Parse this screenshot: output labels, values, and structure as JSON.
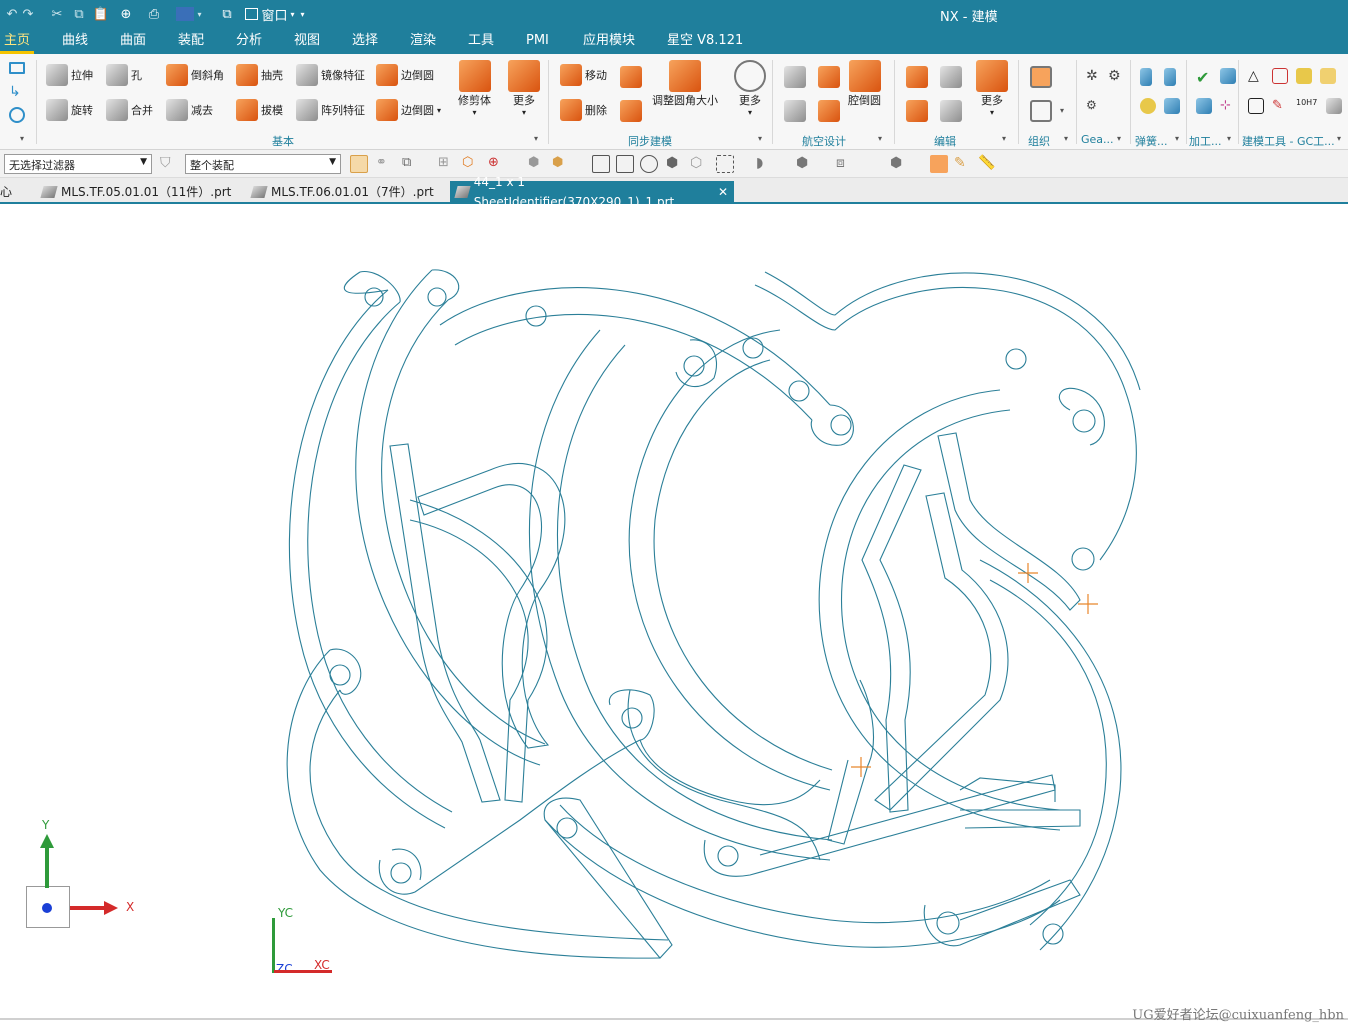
{
  "window": {
    "title": "NX - 建模"
  },
  "quick_access": {
    "window_label": "窗口",
    "icons": [
      "undo-icon",
      "redo-icon",
      "cut-icon",
      "copy-icon",
      "paste-icon",
      "touch-mode-icon",
      "print-icon",
      "display-icon",
      "window-switch-icon"
    ]
  },
  "menu_tabs": [
    {
      "label": "主页",
      "active": true
    },
    {
      "label": "曲线"
    },
    {
      "label": "曲面"
    },
    {
      "label": "装配"
    },
    {
      "label": "分析"
    },
    {
      "label": "视图"
    },
    {
      "label": "选择"
    },
    {
      "label": "渲染"
    },
    {
      "label": "工具"
    },
    {
      "label": "PMI"
    },
    {
      "label": "应用模块"
    },
    {
      "label": "星空 V8.121"
    }
  ],
  "ribbon": {
    "basic": {
      "extrude": "拉伸",
      "hole": "孔",
      "chamfer": "倒斜角",
      "shell": "抽壳",
      "mirror": "镜像特征",
      "edge_blend": "边倒圆",
      "revolve": "旋转",
      "unite": "合并",
      "subtract": "减去",
      "draft": "拔模",
      "pattern": "阵列特征",
      "edge_blend2": "边倒圆",
      "trim_body": "修剪体",
      "more": "更多",
      "label": "基本"
    },
    "sync": {
      "move": "移动",
      "delete": "删除",
      "resize_blend": "调整圆角大小",
      "more": "更多",
      "label": "同步建模"
    },
    "aero": {
      "cavity_blend": "腔倒圆",
      "label": "航空设计"
    },
    "edit": {
      "more": "更多",
      "label": "编辑"
    },
    "organize": {
      "label": "组织"
    },
    "gear": {
      "label": "Gea..."
    },
    "spring": {
      "label": "弹簧..."
    },
    "machining": {
      "label": "加工..."
    },
    "gc": {
      "label": "建模工具 - GC工..."
    }
  },
  "filterbar": {
    "type_filter": "无选择过滤器",
    "assembly_scope": "整个装配"
  },
  "doc_tabs": [
    {
      "label": "心"
    },
    {
      "label": "MLS.TF.05.01.01（11件）.prt"
    },
    {
      "label": "MLS.TF.06.01.01（7件）.prt"
    },
    {
      "label": "44_1 x 1 SheetIdentifier(370X290_1)_1.prt",
      "active": true
    }
  ],
  "triad": {
    "x": "X",
    "y": "Y"
  },
  "wcs": {
    "xc": "XC",
    "yc": "YC",
    "zc": "ZC"
  },
  "colors": {
    "brand": "#1f7f9c",
    "accent": "#f5c400",
    "geometry": "#2b7f98",
    "marker": "#e8872c",
    "axis_x": "#d42a2a",
    "axis_y": "#2e9a3a",
    "axis_z": "#1a3fd6"
  },
  "watermark": "UG爱好者论坛@cuixuanfeng_hbn"
}
